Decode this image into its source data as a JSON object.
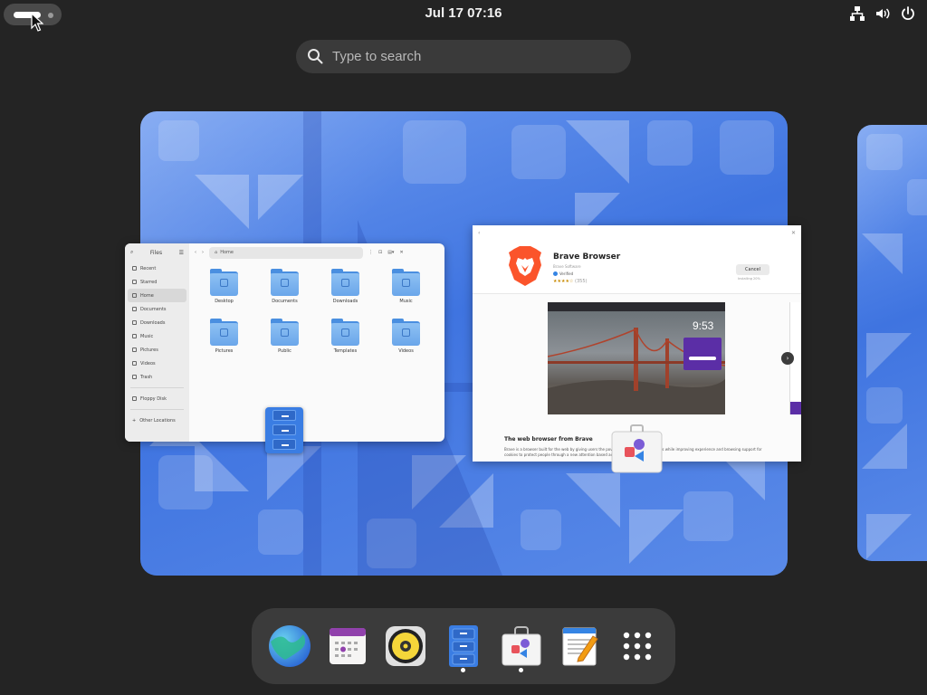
{
  "topbar": {
    "clock": "Jul 17  07:16",
    "tray_icons": [
      "network-icon",
      "volume-icon",
      "power-icon"
    ]
  },
  "search": {
    "placeholder": "Type to search"
  },
  "files_window": {
    "title": "Files",
    "path": "Home",
    "sidebar": [
      "Recent",
      "Starred",
      "Home",
      "Documents",
      "Downloads",
      "Music",
      "Pictures",
      "Videos",
      "Trash"
    ],
    "sidebar_extra": [
      "Floppy Disk",
      "Other Locations"
    ],
    "active_item": "Home",
    "folders": [
      "Desktop",
      "Documents",
      "Downloads",
      "Music",
      "Pictures",
      "Public",
      "Templates",
      "Videos"
    ]
  },
  "software_window": {
    "app_name": "Brave Browser",
    "developer": "Brave Software",
    "verified": "Verified",
    "rating_count": "(355)",
    "cancel_label": "Cancel",
    "cancel_sub": "Installing 20%",
    "screenshot_time": "9:53",
    "description_title": "The web browser from Brave",
    "description_body": "Brave is a browser built for the web by giving users the power to block trackers and ads while improving experience and browsing support for cookies to protect people through a new attention based ad system."
  },
  "dock": {
    "apps": [
      "Web Browser",
      "Calendar",
      "Rhythmbox",
      "Files",
      "Software",
      "Text Editor",
      "Show Apps"
    ],
    "running": [
      "Files",
      "Software"
    ]
  },
  "colors": {
    "panel": "#242424",
    "accent": "#3584e4",
    "wallpaper": "#4a7de6"
  }
}
